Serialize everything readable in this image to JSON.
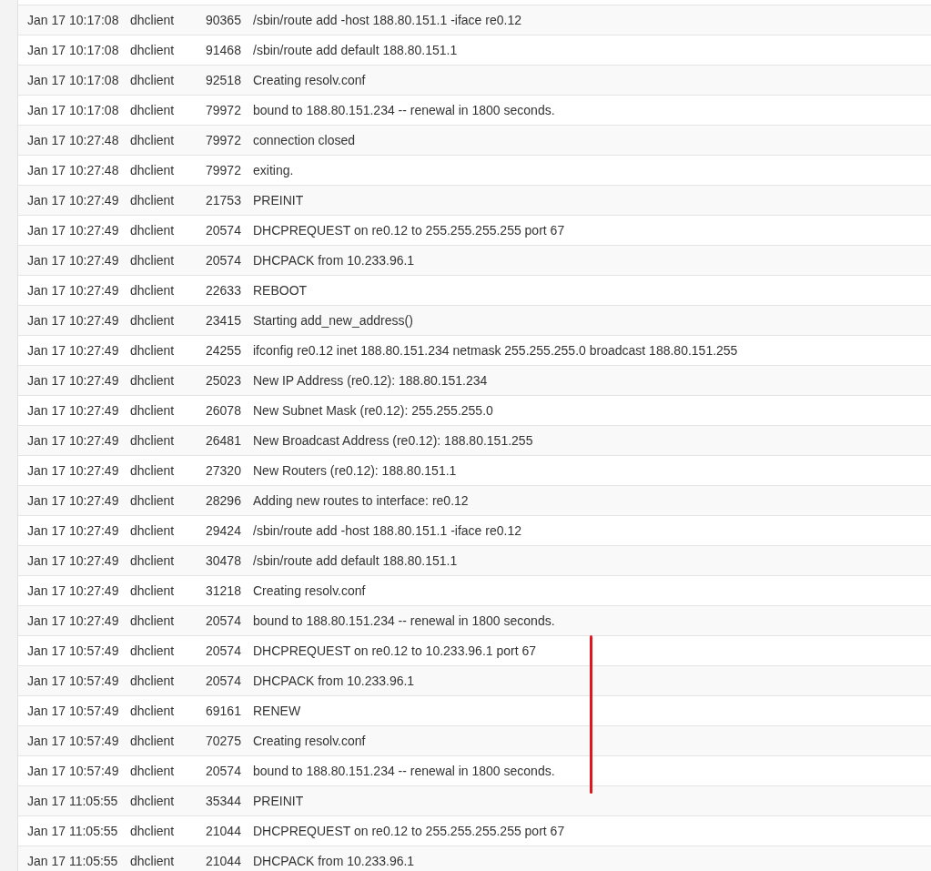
{
  "log_rows": [
    {
      "time": "Jan 17 10:17:08",
      "process": "dhclient",
      "pid": "90365",
      "message": "/sbin/route add -host 188.80.151.1 -iface re0.12"
    },
    {
      "time": "Jan 17 10:17:08",
      "process": "dhclient",
      "pid": "91468",
      "message": "/sbin/route add default 188.80.151.1"
    },
    {
      "time": "Jan 17 10:17:08",
      "process": "dhclient",
      "pid": "92518",
      "message": "Creating resolv.conf"
    },
    {
      "time": "Jan 17 10:17:08",
      "process": "dhclient",
      "pid": "79972",
      "message": "bound to 188.80.151.234 -- renewal in 1800 seconds."
    },
    {
      "time": "Jan 17 10:27:48",
      "process": "dhclient",
      "pid": "79972",
      "message": "connection closed"
    },
    {
      "time": "Jan 17 10:27:48",
      "process": "dhclient",
      "pid": "79972",
      "message": "exiting."
    },
    {
      "time": "Jan 17 10:27:49",
      "process": "dhclient",
      "pid": "21753",
      "message": "PREINIT"
    },
    {
      "time": "Jan 17 10:27:49",
      "process": "dhclient",
      "pid": "20574",
      "message": "DHCPREQUEST on re0.12 to 255.255.255.255 port 67"
    },
    {
      "time": "Jan 17 10:27:49",
      "process": "dhclient",
      "pid": "20574",
      "message": "DHCPACK from 10.233.96.1"
    },
    {
      "time": "Jan 17 10:27:49",
      "process": "dhclient",
      "pid": "22633",
      "message": "REBOOT"
    },
    {
      "time": "Jan 17 10:27:49",
      "process": "dhclient",
      "pid": "23415",
      "message": "Starting add_new_address()"
    },
    {
      "time": "Jan 17 10:27:49",
      "process": "dhclient",
      "pid": "24255",
      "message": "ifconfig re0.12 inet 188.80.151.234 netmask 255.255.255.0 broadcast 188.80.151.255"
    },
    {
      "time": "Jan 17 10:27:49",
      "process": "dhclient",
      "pid": "25023",
      "message": "New IP Address (re0.12): 188.80.151.234"
    },
    {
      "time": "Jan 17 10:27:49",
      "process": "dhclient",
      "pid": "26078",
      "message": "New Subnet Mask (re0.12): 255.255.255.0"
    },
    {
      "time": "Jan 17 10:27:49",
      "process": "dhclient",
      "pid": "26481",
      "message": "New Broadcast Address (re0.12): 188.80.151.255"
    },
    {
      "time": "Jan 17 10:27:49",
      "process": "dhclient",
      "pid": "27320",
      "message": "New Routers (re0.12): 188.80.151.1"
    },
    {
      "time": "Jan 17 10:27:49",
      "process": "dhclient",
      "pid": "28296",
      "message": "Adding new routes to interface: re0.12"
    },
    {
      "time": "Jan 17 10:27:49",
      "process": "dhclient",
      "pid": "29424",
      "message": "/sbin/route add -host 188.80.151.1 -iface re0.12"
    },
    {
      "time": "Jan 17 10:27:49",
      "process": "dhclient",
      "pid": "30478",
      "message": "/sbin/route add default 188.80.151.1"
    },
    {
      "time": "Jan 17 10:27:49",
      "process": "dhclient",
      "pid": "31218",
      "message": "Creating resolv.conf"
    },
    {
      "time": "Jan 17 10:27:49",
      "process": "dhclient",
      "pid": "20574",
      "message": "bound to 188.80.151.234 -- renewal in 1800 seconds."
    },
    {
      "time": "Jan 17 10:57:49",
      "process": "dhclient",
      "pid": "20574",
      "message": "DHCPREQUEST on re0.12 to 10.233.96.1 port 67"
    },
    {
      "time": "Jan 17 10:57:49",
      "process": "dhclient",
      "pid": "20574",
      "message": "DHCPACK from 10.233.96.1"
    },
    {
      "time": "Jan 17 10:57:49",
      "process": "dhclient",
      "pid": "69161",
      "message": "RENEW"
    },
    {
      "time": "Jan 17 10:57:49",
      "process": "dhclient",
      "pid": "70275",
      "message": "Creating resolv.conf"
    },
    {
      "time": "Jan 17 10:57:49",
      "process": "dhclient",
      "pid": "20574",
      "message": "bound to 188.80.151.234 -- renewal in 1800 seconds."
    },
    {
      "time": "Jan 17 11:05:55",
      "process": "dhclient",
      "pid": "35344",
      "message": "PREINIT"
    },
    {
      "time": "Jan 17 11:05:55",
      "process": "dhclient",
      "pid": "21044",
      "message": "DHCPREQUEST on re0.12 to 255.255.255.255 port 67"
    },
    {
      "time": "Jan 17 11:05:55",
      "process": "dhclient",
      "pid": "21044",
      "message": "DHCPACK from 10.233.96.1"
    }
  ]
}
